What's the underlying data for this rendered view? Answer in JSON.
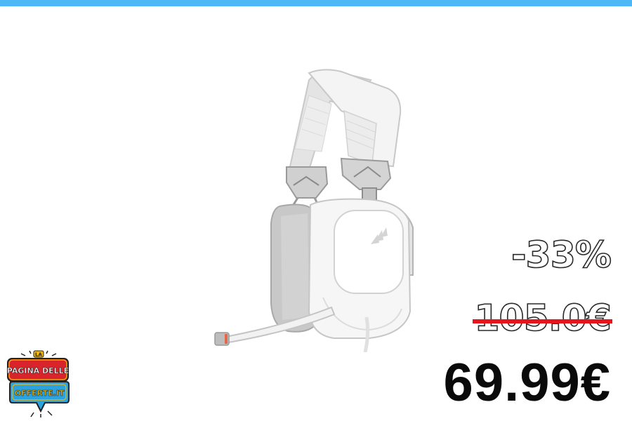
{
  "banner": {
    "accent_color": "#4db8f5"
  },
  "product": {
    "image_icon": "white-gaming-headset-icon",
    "brand_mark_icon": "sails-logo-icon"
  },
  "pricing": {
    "discount": "-33%",
    "old_price": "105.0€",
    "new_price": "69.99€",
    "strike_color": "#e8141c"
  },
  "logo": {
    "line1": "LA",
    "line2": "PAGINA DELLE",
    "line3": "OFFERTE.IT",
    "badge_color": "#f2b705",
    "bubble_color": "#2aa3e0",
    "plate_color": "#d8242a"
  }
}
